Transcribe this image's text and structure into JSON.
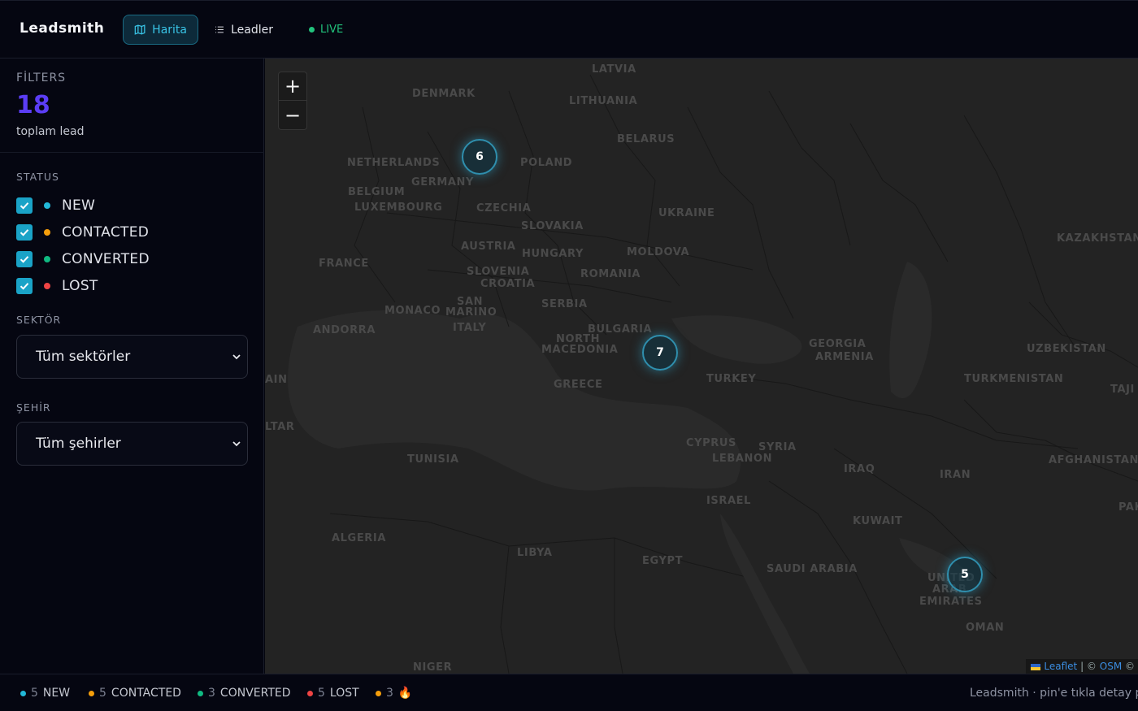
{
  "header": {
    "brand": "Leadsmith",
    "tabs": [
      {
        "label": "Harita",
        "icon": "map-icon",
        "active": true
      },
      {
        "label": "Leadler",
        "icon": "list-icon",
        "active": false
      }
    ],
    "live_label": "LIVE"
  },
  "sidebar": {
    "filters_title": "FİLTERS",
    "total": "18",
    "total_label": "toplam lead",
    "status_title": "STATUS",
    "statuses": [
      {
        "label": "NEW",
        "color": "#22b8d8",
        "checked": true
      },
      {
        "label": "CONTACTED",
        "color": "#f59e0b",
        "checked": true
      },
      {
        "label": "CONVERTED",
        "color": "#10b981",
        "checked": true
      },
      {
        "label": "LOST",
        "color": "#ef4444",
        "checked": true
      }
    ],
    "sector_title": "SEKTÖR",
    "sector_value": "Tüm sektörler",
    "city_title": "ŞEHİR",
    "city_value": "Tüm şehirler"
  },
  "map": {
    "zoom_in": "+",
    "zoom_out": "−",
    "clusters": [
      "6",
      "7",
      "5"
    ],
    "countries": [
      "LATVIA",
      "DENMARK",
      "LITHUANIA",
      "BELARUS",
      "NETHERLANDS",
      "POLAND",
      "BELGIUM",
      "GERMANY",
      "LUXEMBOURG",
      "CZECHIA",
      "UKRAINE",
      "SLOVAKIA",
      "KAZAKHSTAN",
      "AUSTRIA",
      "MOLDOVA",
      "HUNGARY",
      "FRANCE",
      "SLOVENIA",
      "ROMANIA",
      "CROATIA",
      "SAN",
      "MARINO",
      "SERBIA",
      "MONACO",
      "ANDORRA",
      "ITALY",
      "BULGARIA",
      "NORTH",
      "MACEDONIA",
      "GEORGIA",
      "ARMENIA",
      "UZBEKISTAN",
      "AIN",
      "TURKEY",
      "TURKMENISTAN",
      "TAJI",
      "GREECE",
      "LTAR",
      "CYPRUS",
      "SYRIA",
      "TUNISIA",
      "LEBANON",
      "IRAQ",
      "IRAN",
      "AFGHANISTAN",
      "ISRAEL",
      "PAK",
      "KUWAIT",
      "ALGERIA",
      "LIBYA",
      "EGYPT",
      "SAUDI ARABIA",
      "UNITED",
      "ARAB",
      "EMIRATES",
      "OMAN",
      "NIGER"
    ],
    "attribution_leaflet": "Leaflet",
    "attribution_sep": "| ©",
    "attribution_osm": "OSM",
    "attribution_tail": "©"
  },
  "footer": {
    "items": [
      {
        "count": "5",
        "label": "NEW",
        "color": "#22b8d8"
      },
      {
        "count": "5",
        "label": "CONTACTED",
        "color": "#f59e0b"
      },
      {
        "count": "3",
        "label": "CONVERTED",
        "color": "#10b981"
      },
      {
        "count": "5",
        "label": "LOST",
        "color": "#ef4444"
      },
      {
        "count": "3",
        "label": "🔥",
        "color": "#f59e0b"
      }
    ],
    "right_text": "Leadsmith · pin'e tıkla detay po"
  }
}
